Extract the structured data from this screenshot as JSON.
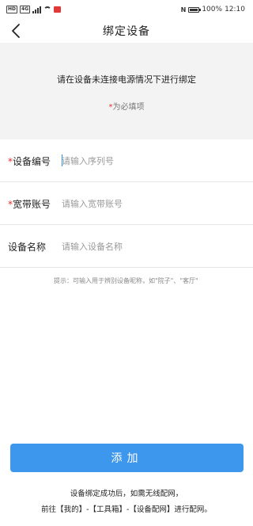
{
  "status_bar": {
    "left_chips": [
      "HD",
      "4G"
    ],
    "nfc": "N",
    "battery": "100%",
    "battery_level": 1.0,
    "time": "12:10"
  },
  "nav": {
    "title": "绑定设备",
    "back_icon": "chevron-left-icon"
  },
  "notice": {
    "text": "请在设备未连接电源情况下进行绑定",
    "required_star": "*",
    "required_text": "为必填项"
  },
  "form": {
    "rows": [
      {
        "star": "*",
        "label": "设备编号",
        "placeholder": "请输入序列号",
        "value": ""
      },
      {
        "star": "*",
        "label": "宽带账号",
        "placeholder": "请输入宽带账号",
        "value": ""
      },
      {
        "star": "",
        "label": "设备名称",
        "placeholder": "请输入设备名称",
        "value": ""
      }
    ],
    "hint": "提示：可输入用于辨别设备昵称，如\"院子\"、\"客厅\""
  },
  "add_button": {
    "label": "添加"
  },
  "footer": {
    "line1": "设备绑定成功后，如需无线配网，",
    "line2": "前往【我的】-【工具箱】-【设备配网】进行配网。"
  },
  "colors": {
    "accent": "#3d97ec",
    "required_red": "#e3302f",
    "panel_bg": "#f3f3f3"
  }
}
